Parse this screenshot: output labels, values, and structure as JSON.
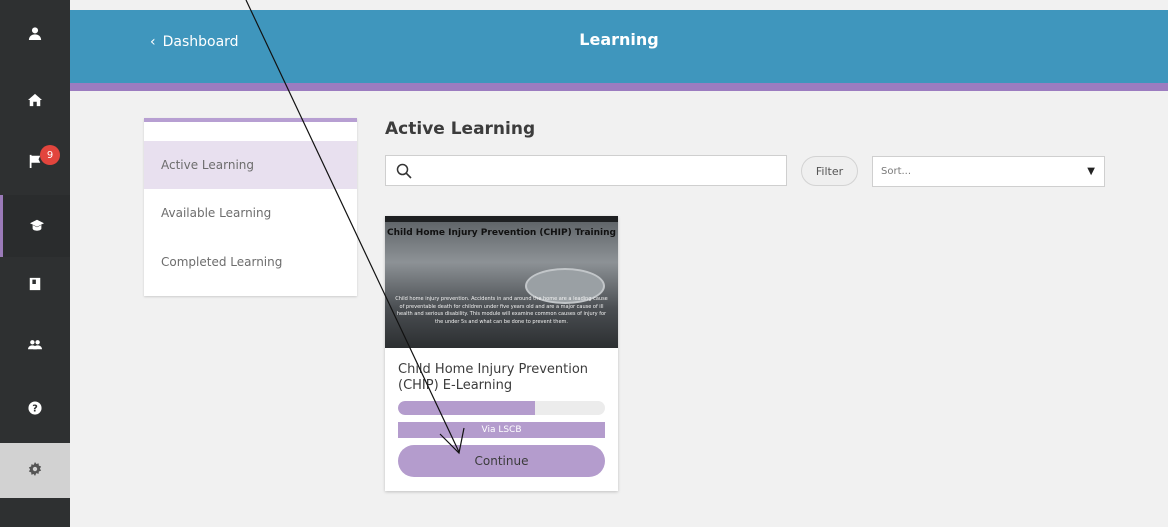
{
  "header": {
    "back_label": "Dashboard",
    "title": "Learning"
  },
  "rail": {
    "items": [
      {
        "icon": "user-icon"
      },
      {
        "icon": "home-icon"
      },
      {
        "icon": "flag-icon",
        "badge": "9"
      },
      {
        "icon": "graduation-cap-icon",
        "active": true
      },
      {
        "icon": "book-icon"
      },
      {
        "icon": "users-icon"
      },
      {
        "icon": "help-icon"
      },
      {
        "icon": "gear-icon"
      }
    ]
  },
  "side_menu": {
    "items": [
      {
        "label": "Active Learning",
        "active": true
      },
      {
        "label": "Available Learning"
      },
      {
        "label": "Completed Learning"
      }
    ]
  },
  "main": {
    "section_title": "Active Learning",
    "search": {
      "value": "",
      "placeholder": ""
    },
    "filter_label": "Filter",
    "sort": {
      "value": "Sort..."
    }
  },
  "course": {
    "image_title": "Child Home Injury Prevention (CHIP) Training",
    "image_text": "Child home injury prevention. Accidents in and around the home are a leading cause of preventable death for children under five years old and are a major cause of ill health and serious disability. This module will examine common causes of injury for the under 5s and what can be done to prevent them.",
    "title": "Child Home Injury Prevention (CHIP) E-Learning",
    "progress_percent": 66,
    "provider": "Via LSCB",
    "continue_label": "Continue"
  },
  "colors": {
    "header": "#3f96bd",
    "accent": "#9c7cc0",
    "button": "#b49ccd",
    "rail": "#2e3031",
    "badge": "#e2453d"
  }
}
